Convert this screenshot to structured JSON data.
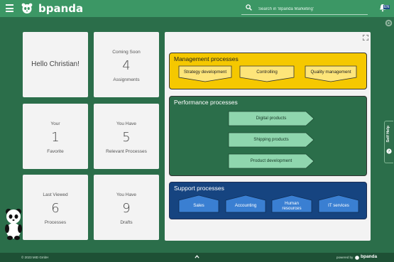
{
  "app": {
    "brand": "bpanda",
    "search_placeholder": "Search in 'Bpanda Marketing'",
    "language": "EN"
  },
  "cards": {
    "hello": "Hello Christian!",
    "coming_soon": {
      "top": "Coming Soon",
      "value": "4",
      "bottom": "Assignments"
    },
    "favorite": {
      "top": "Your",
      "value": "1",
      "bottom": "Favorite"
    },
    "relevant": {
      "top": "You Have",
      "value": "5",
      "bottom": "Relevant Processes"
    },
    "last_viewed": {
      "top": "Last Viewed",
      "value": "6",
      "bottom": "Processes"
    },
    "drafts": {
      "top": "You Have",
      "value": "9",
      "bottom": "Drafts"
    }
  },
  "process_map": {
    "management": {
      "title": "Management processes",
      "items": [
        "Strategy development",
        "Controlling",
        "Quality management"
      ]
    },
    "performance": {
      "title": "Performance processes",
      "items": [
        "Digital products",
        "Shipping products",
        "Product development"
      ]
    },
    "support": {
      "title": "Support processes",
      "items": [
        "Sales",
        "Accounting",
        "Human resources",
        "IT services"
      ]
    }
  },
  "self_help": {
    "label": "Self Help"
  },
  "footer": {
    "copyright": "© 2023 MID GmbH",
    "powered_by": "powered by",
    "brand": "bpanda"
  },
  "colors": {
    "background": "#2b6e4a",
    "topbar": "#3c9765",
    "management": "#f5c800",
    "performance_item": "#8fd6ae",
    "support": "#164480",
    "support_item": "#3a7fd2"
  },
  "icons": [
    "menu-icon",
    "panda-logo-icon",
    "search-icon",
    "bell-icon",
    "settings-icon",
    "fullscreen-icon",
    "chevron-up-icon",
    "question-icon"
  ]
}
